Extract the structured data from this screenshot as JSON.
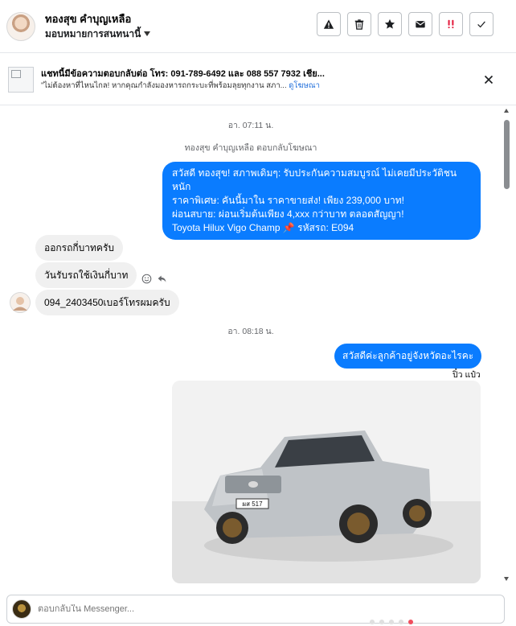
{
  "header": {
    "contact_name": "ทองสุข คำบุญเหลือ",
    "assign_label": "มอบหมายการสนทนานี้",
    "actions": [
      {
        "name": "spam-button",
        "icon": "warning-icon"
      },
      {
        "name": "delete-button",
        "icon": "trash-icon"
      },
      {
        "name": "star-button",
        "icon": "star-icon"
      },
      {
        "name": "mark-unread-button",
        "icon": "envelope-icon"
      },
      {
        "name": "follow-up-button",
        "icon": "exclamation-icon"
      },
      {
        "name": "done-button",
        "icon": "checkmark-icon"
      }
    ]
  },
  "ad_context": {
    "title": "แชทนี้มีข้อความตอบกลับต่อ โทร: 091-789-6492 และ 088 557 7932 เชีย...",
    "subtitle": "\"ไม่ต้องหาที่ไหนไกล! หากคุณกำลังมองหารถกระบะที่พร้อมลุยทุกงาน สภา...",
    "link": "ดูโฆษณา"
  },
  "conversation": {
    "timestamp_1": "อา. 07:11 น.",
    "ad_reply_note": "ทองสุข คำบุญเหลือ ตอบกลับโฆษณา",
    "outgoing_1": [
      "สวัสดี ทองสุข! สภาพเดิมๆ: รับประกันความสมบูรณ์ ไม่เคยมีประวัติชนหนัก",
      "ราคาพิเศษ: คันนี้มาใน ราคาขายส่ง! เพียง 239,000 บาท!",
      "ผ่อนสบาย: ผ่อนเริ่มต้นเพียง 4,xxx กว่าบาท ตลอดสัญญา!",
      "Toyota Hilux Vigo Champ 📌 รหัสรถ: E094"
    ],
    "incoming": [
      "ออกรถกี่บาทครับ",
      "วันรับรถใช้เงินกี่บาท",
      "094_2403450เบอร์โทรผมครับ"
    ],
    "timestamp_2": "อา. 08:18 น.",
    "outgoing_2": "สวัสดีค่ะลูกค้าอยู่จังหวัดอะไรคะ",
    "seen_status": "ปิ๋ว แป๋ว",
    "photo_plate": "ผส 517"
  },
  "composer": {
    "placeholder": "ตอบกลับใน Messenger..."
  },
  "colors": {
    "outgoing_bubble": "#0a7cff",
    "incoming_bubble": "#f0f0f0",
    "link": "#216fdb",
    "follow_up_red": "#e41e3f"
  }
}
